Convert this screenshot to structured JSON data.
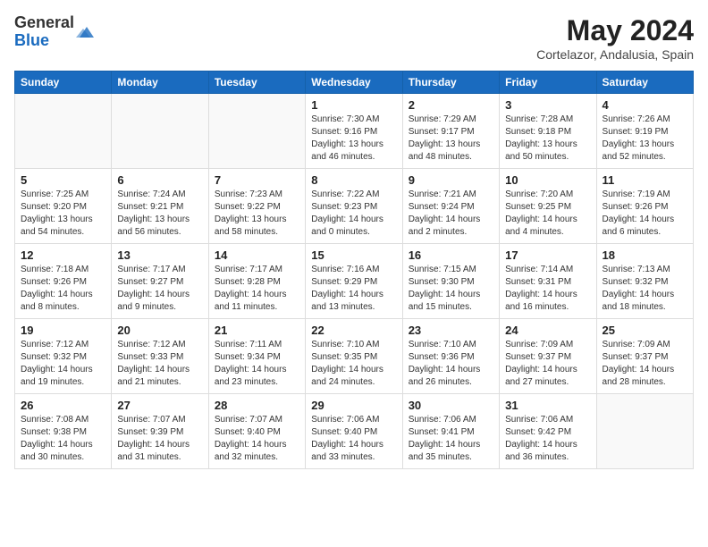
{
  "header": {
    "logo_general": "General",
    "logo_blue": "Blue",
    "month_year": "May 2024",
    "location": "Cortelazor, Andalusia, Spain"
  },
  "weekdays": [
    "Sunday",
    "Monday",
    "Tuesday",
    "Wednesday",
    "Thursday",
    "Friday",
    "Saturday"
  ],
  "weeks": [
    [
      {
        "day": "",
        "sunrise": "",
        "sunset": "",
        "daylight": ""
      },
      {
        "day": "",
        "sunrise": "",
        "sunset": "",
        "daylight": ""
      },
      {
        "day": "",
        "sunrise": "",
        "sunset": "",
        "daylight": ""
      },
      {
        "day": "1",
        "sunrise": "Sunrise: 7:30 AM",
        "sunset": "Sunset: 9:16 PM",
        "daylight": "Daylight: 13 hours and 46 minutes."
      },
      {
        "day": "2",
        "sunrise": "Sunrise: 7:29 AM",
        "sunset": "Sunset: 9:17 PM",
        "daylight": "Daylight: 13 hours and 48 minutes."
      },
      {
        "day": "3",
        "sunrise": "Sunrise: 7:28 AM",
        "sunset": "Sunset: 9:18 PM",
        "daylight": "Daylight: 13 hours and 50 minutes."
      },
      {
        "day": "4",
        "sunrise": "Sunrise: 7:26 AM",
        "sunset": "Sunset: 9:19 PM",
        "daylight": "Daylight: 13 hours and 52 minutes."
      }
    ],
    [
      {
        "day": "5",
        "sunrise": "Sunrise: 7:25 AM",
        "sunset": "Sunset: 9:20 PM",
        "daylight": "Daylight: 13 hours and 54 minutes."
      },
      {
        "day": "6",
        "sunrise": "Sunrise: 7:24 AM",
        "sunset": "Sunset: 9:21 PM",
        "daylight": "Daylight: 13 hours and 56 minutes."
      },
      {
        "day": "7",
        "sunrise": "Sunrise: 7:23 AM",
        "sunset": "Sunset: 9:22 PM",
        "daylight": "Daylight: 13 hours and 58 minutes."
      },
      {
        "day": "8",
        "sunrise": "Sunrise: 7:22 AM",
        "sunset": "Sunset: 9:23 PM",
        "daylight": "Daylight: 14 hours and 0 minutes."
      },
      {
        "day": "9",
        "sunrise": "Sunrise: 7:21 AM",
        "sunset": "Sunset: 9:24 PM",
        "daylight": "Daylight: 14 hours and 2 minutes."
      },
      {
        "day": "10",
        "sunrise": "Sunrise: 7:20 AM",
        "sunset": "Sunset: 9:25 PM",
        "daylight": "Daylight: 14 hours and 4 minutes."
      },
      {
        "day": "11",
        "sunrise": "Sunrise: 7:19 AM",
        "sunset": "Sunset: 9:26 PM",
        "daylight": "Daylight: 14 hours and 6 minutes."
      }
    ],
    [
      {
        "day": "12",
        "sunrise": "Sunrise: 7:18 AM",
        "sunset": "Sunset: 9:26 PM",
        "daylight": "Daylight: 14 hours and 8 minutes."
      },
      {
        "day": "13",
        "sunrise": "Sunrise: 7:17 AM",
        "sunset": "Sunset: 9:27 PM",
        "daylight": "Daylight: 14 hours and 9 minutes."
      },
      {
        "day": "14",
        "sunrise": "Sunrise: 7:17 AM",
        "sunset": "Sunset: 9:28 PM",
        "daylight": "Daylight: 14 hours and 11 minutes."
      },
      {
        "day": "15",
        "sunrise": "Sunrise: 7:16 AM",
        "sunset": "Sunset: 9:29 PM",
        "daylight": "Daylight: 14 hours and 13 minutes."
      },
      {
        "day": "16",
        "sunrise": "Sunrise: 7:15 AM",
        "sunset": "Sunset: 9:30 PM",
        "daylight": "Daylight: 14 hours and 15 minutes."
      },
      {
        "day": "17",
        "sunrise": "Sunrise: 7:14 AM",
        "sunset": "Sunset: 9:31 PM",
        "daylight": "Daylight: 14 hours and 16 minutes."
      },
      {
        "day": "18",
        "sunrise": "Sunrise: 7:13 AM",
        "sunset": "Sunset: 9:32 PM",
        "daylight": "Daylight: 14 hours and 18 minutes."
      }
    ],
    [
      {
        "day": "19",
        "sunrise": "Sunrise: 7:12 AM",
        "sunset": "Sunset: 9:32 PM",
        "daylight": "Daylight: 14 hours and 19 minutes."
      },
      {
        "day": "20",
        "sunrise": "Sunrise: 7:12 AM",
        "sunset": "Sunset: 9:33 PM",
        "daylight": "Daylight: 14 hours and 21 minutes."
      },
      {
        "day": "21",
        "sunrise": "Sunrise: 7:11 AM",
        "sunset": "Sunset: 9:34 PM",
        "daylight": "Daylight: 14 hours and 23 minutes."
      },
      {
        "day": "22",
        "sunrise": "Sunrise: 7:10 AM",
        "sunset": "Sunset: 9:35 PM",
        "daylight": "Daylight: 14 hours and 24 minutes."
      },
      {
        "day": "23",
        "sunrise": "Sunrise: 7:10 AM",
        "sunset": "Sunset: 9:36 PM",
        "daylight": "Daylight: 14 hours and 26 minutes."
      },
      {
        "day": "24",
        "sunrise": "Sunrise: 7:09 AM",
        "sunset": "Sunset: 9:37 PM",
        "daylight": "Daylight: 14 hours and 27 minutes."
      },
      {
        "day": "25",
        "sunrise": "Sunrise: 7:09 AM",
        "sunset": "Sunset: 9:37 PM",
        "daylight": "Daylight: 14 hours and 28 minutes."
      }
    ],
    [
      {
        "day": "26",
        "sunrise": "Sunrise: 7:08 AM",
        "sunset": "Sunset: 9:38 PM",
        "daylight": "Daylight: 14 hours and 30 minutes."
      },
      {
        "day": "27",
        "sunrise": "Sunrise: 7:07 AM",
        "sunset": "Sunset: 9:39 PM",
        "daylight": "Daylight: 14 hours and 31 minutes."
      },
      {
        "day": "28",
        "sunrise": "Sunrise: 7:07 AM",
        "sunset": "Sunset: 9:40 PM",
        "daylight": "Daylight: 14 hours and 32 minutes."
      },
      {
        "day": "29",
        "sunrise": "Sunrise: 7:06 AM",
        "sunset": "Sunset: 9:40 PM",
        "daylight": "Daylight: 14 hours and 33 minutes."
      },
      {
        "day": "30",
        "sunrise": "Sunrise: 7:06 AM",
        "sunset": "Sunset: 9:41 PM",
        "daylight": "Daylight: 14 hours and 35 minutes."
      },
      {
        "day": "31",
        "sunrise": "Sunrise: 7:06 AM",
        "sunset": "Sunset: 9:42 PM",
        "daylight": "Daylight: 14 hours and 36 minutes."
      },
      {
        "day": "",
        "sunrise": "",
        "sunset": "",
        "daylight": ""
      }
    ]
  ]
}
